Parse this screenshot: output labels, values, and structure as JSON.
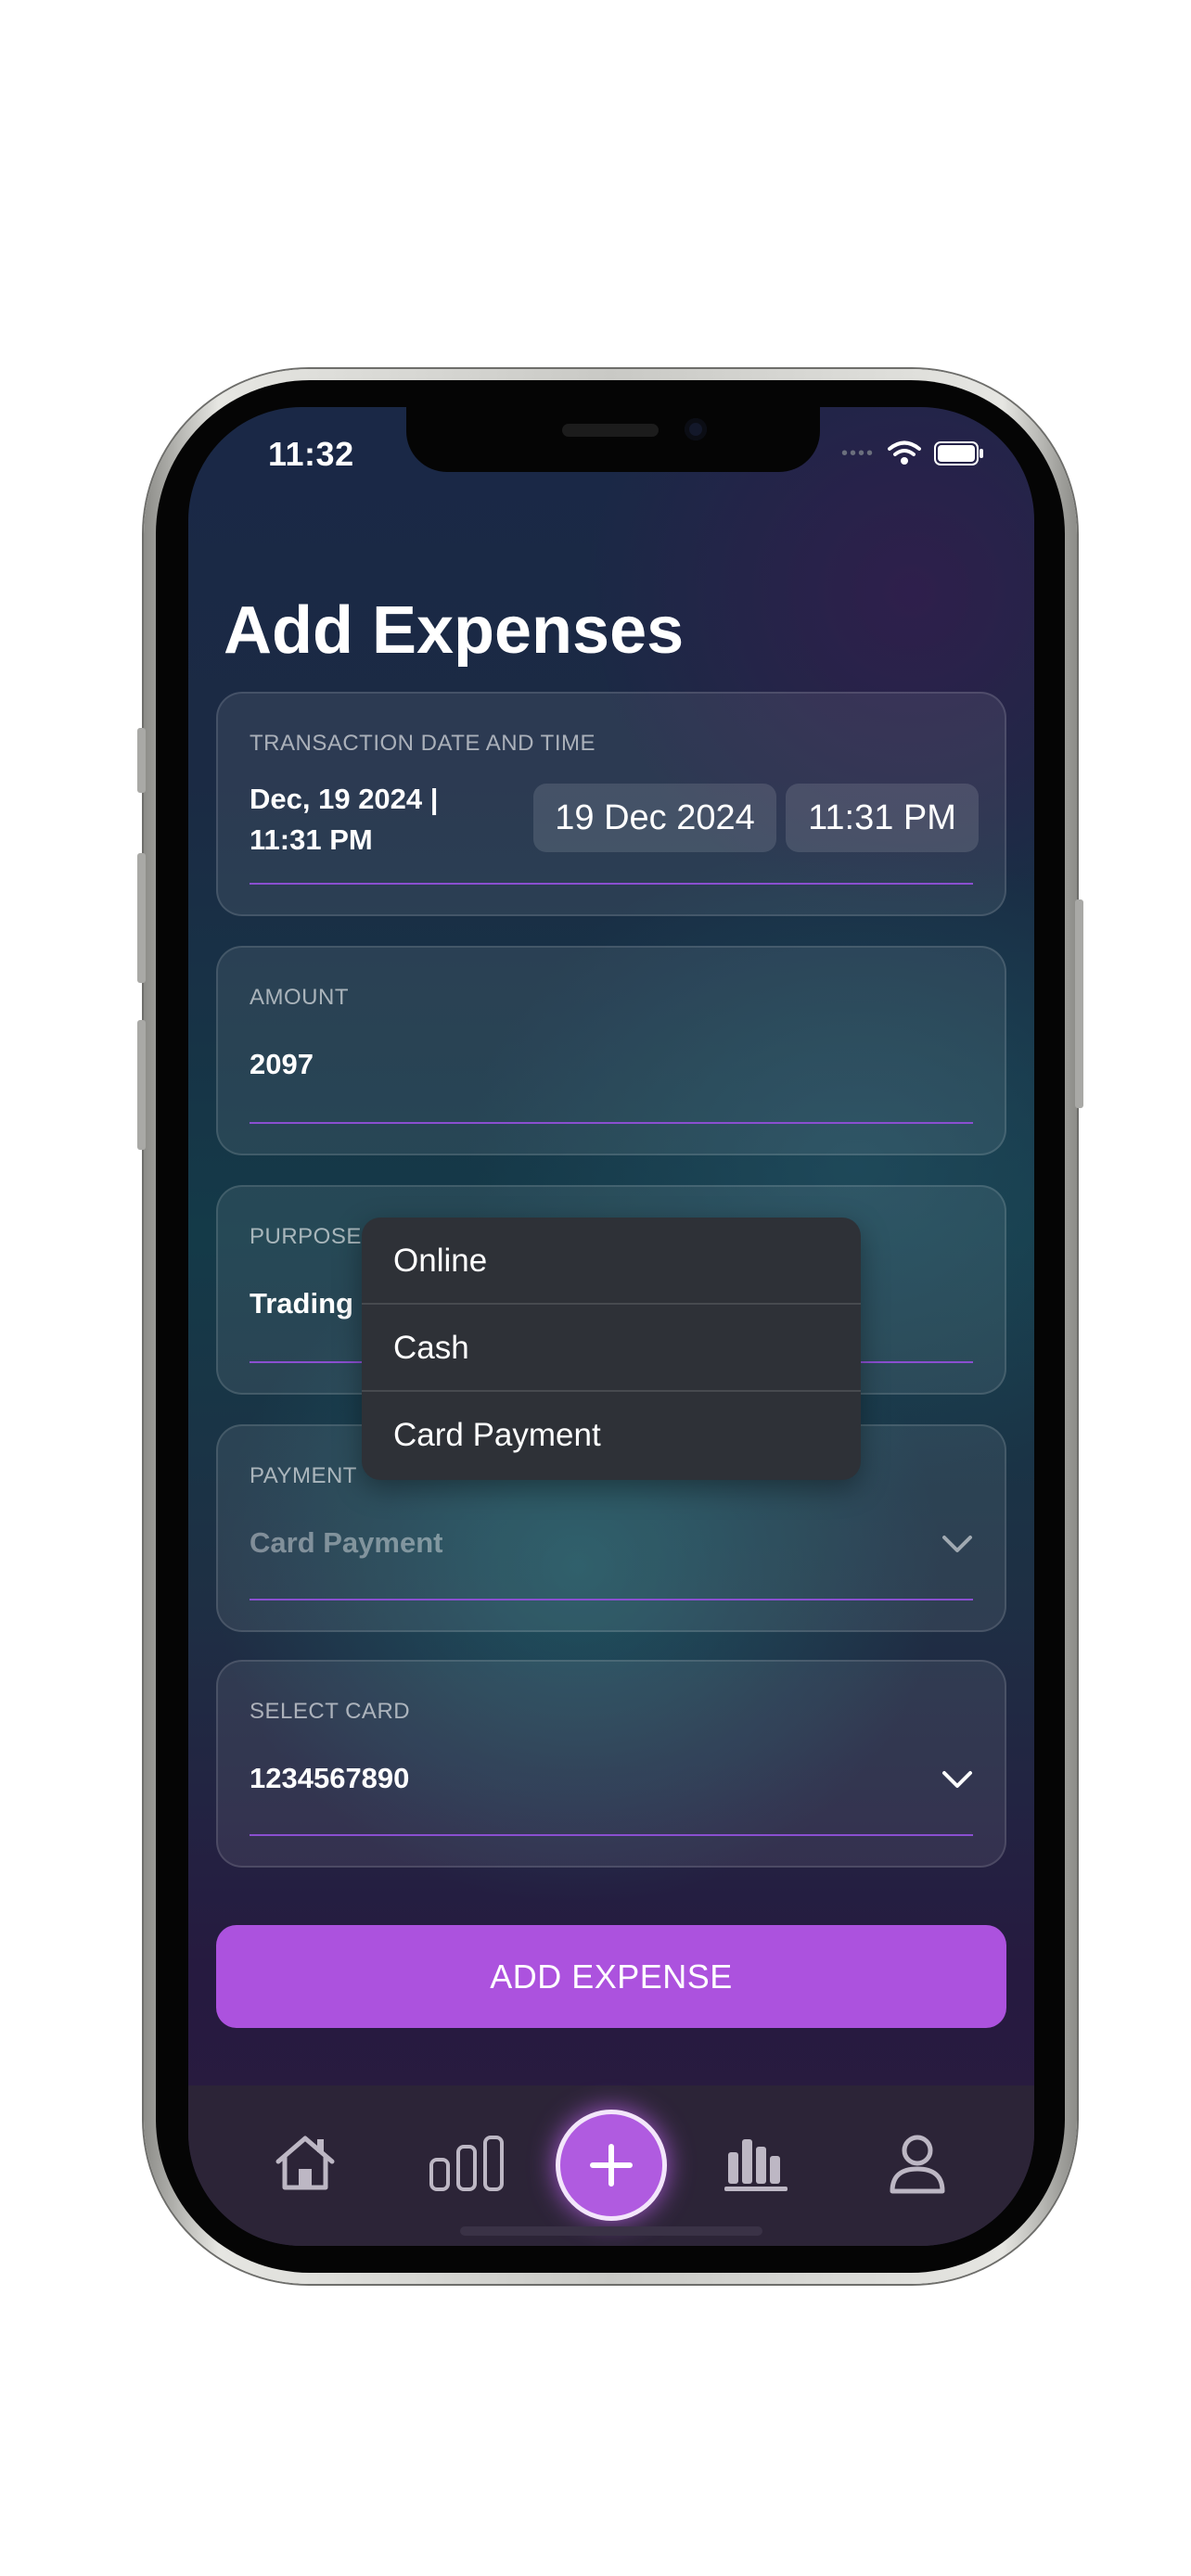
{
  "status_bar": {
    "time": "11:32"
  },
  "page": {
    "title": "Add Expenses"
  },
  "transaction": {
    "label": "TRANSACTION DATE AND TIME",
    "value_line1": "Dec, 19 2024 |",
    "value_line2": "11:31 PM",
    "date_pill": "19 Dec 2024",
    "time_pill": "11:31 PM"
  },
  "amount": {
    "label": "AMOUNT",
    "value": "2097"
  },
  "purpose": {
    "label": "PURPOSE",
    "value": "Trading"
  },
  "payment": {
    "label": "PAYMENT",
    "value": "Card Payment"
  },
  "dropdown": {
    "options": [
      "Online",
      "Cash",
      "Card Payment"
    ]
  },
  "card": {
    "label": "SELECT CARD",
    "value": "1234567890"
  },
  "button": {
    "label": "ADD EXPENSE"
  },
  "tab_bar": {
    "icons": [
      "home-icon",
      "bar-chart-outline-icon",
      "add-icon",
      "stats-icon",
      "profile-icon"
    ]
  },
  "colors": {
    "accent": "#ac52de",
    "underline": "#8a4fd0",
    "tab_bar": "#2c2437"
  }
}
